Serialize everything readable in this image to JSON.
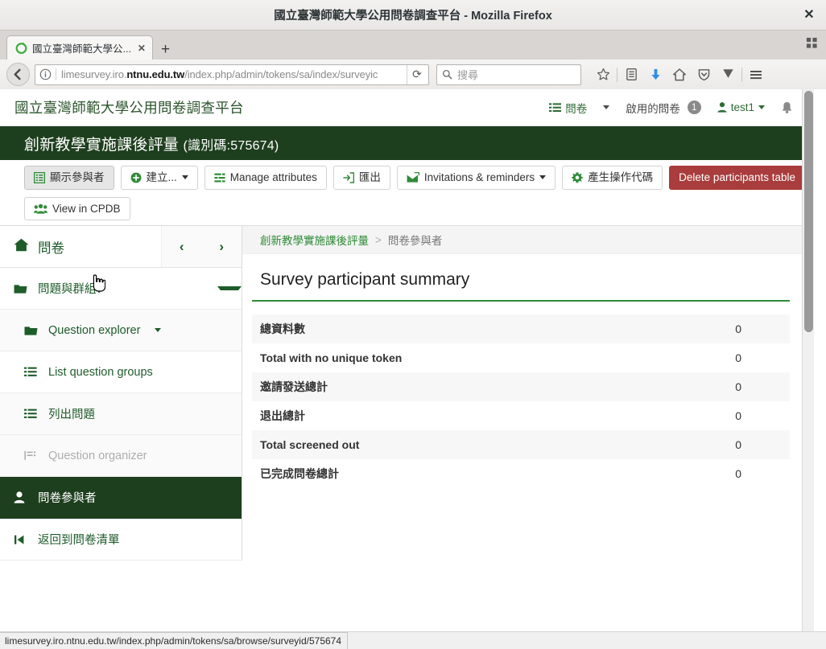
{
  "browser": {
    "window_title": "國立臺灣師範大學公用問卷調查平台 - Mozilla Firefox",
    "close_label": "✕",
    "tab": {
      "label": "國立臺灣師範大學公...",
      "close_label": "✕"
    },
    "new_tab_label": "+",
    "url_prefix": "limesurvey.iro.",
    "url_host_bold": "ntnu.edu.tw",
    "url_suffix": "/index.php/admin/tokens/sa/index/surveyic",
    "reload_label": "⟳",
    "search_placeholder": "搜尋",
    "icons": {
      "back": "back-arrow-icon",
      "identity": "page-info-icon",
      "bookmark_star": "star-icon",
      "library": "library-icon",
      "downloads": "download-arrow-icon",
      "home": "home-icon",
      "shield": "shield-icon",
      "pocket": "pocket-icon",
      "menu": "hamburger-menu-icon"
    },
    "status_url": "limesurvey.iro.ntnu.edu.tw/index.php/admin/tokens/sa/browse/surveyid/575674"
  },
  "app": {
    "brand": "國立臺灣師範大學公用問卷調查平台",
    "topnav": {
      "surveys_label": "問卷",
      "active_surveys_label": "啟用的問卷",
      "active_surveys_count": "1",
      "user_label": "test1",
      "bell_label": "notification-bell"
    },
    "survey_header": {
      "name": "創新教學實施課後評量",
      "id_text": "(識別碼:575674)"
    },
    "toolbar": {
      "buttons": [
        {
          "label": "顯示參與者",
          "icon": "table-list-icon",
          "state": "active",
          "style": "default",
          "caret": false
        },
        {
          "label": "建立...",
          "icon": "plus-circle-icon",
          "state": "normal",
          "style": "default",
          "caret": true
        },
        {
          "label": "Manage attributes",
          "icon": "sliders-icon",
          "state": "normal",
          "style": "default",
          "caret": false
        },
        {
          "label": "匯出",
          "icon": "export-icon",
          "state": "normal",
          "style": "default",
          "caret": false
        },
        {
          "label": "Invitations & reminders",
          "icon": "envelope-icon",
          "state": "normal",
          "style": "default",
          "caret": true
        },
        {
          "label": "產生操作代碼",
          "icon": "gear-icon",
          "state": "normal",
          "style": "default",
          "caret": false
        },
        {
          "label": "Delete participants table",
          "icon": "",
          "state": "normal",
          "style": "danger",
          "caret": false
        }
      ],
      "row2": [
        {
          "label": "View in CPDB",
          "icon": "users-group-icon",
          "state": "normal",
          "style": "default",
          "caret": false
        }
      ]
    },
    "sidebar": {
      "header": {
        "label": "問卷",
        "icon": "home-icon"
      },
      "collapse_prev": "‹",
      "collapse_next": "›",
      "items": [
        {
          "label": "問題與群組：",
          "icon": "folder-icon",
          "caret": true,
          "indent": false,
          "state": "normal",
          "alt": false
        },
        {
          "label": "Question explorer",
          "icon": "folder-icon",
          "caret": true,
          "inline_caret": true,
          "indent": true,
          "state": "normal",
          "alt": true
        },
        {
          "label": "List question groups",
          "icon": "list-icon",
          "caret": false,
          "indent": true,
          "state": "normal",
          "alt": false
        },
        {
          "label": "列出問題",
          "icon": "list-icon",
          "caret": false,
          "indent": true,
          "state": "normal",
          "alt": true
        },
        {
          "label": "Question organizer",
          "icon": "organizer-icon",
          "caret": false,
          "indent": true,
          "state": "disabled",
          "alt": true
        },
        {
          "label": "問卷參與者",
          "icon": "user-icon",
          "caret": false,
          "indent": false,
          "state": "selected",
          "alt": false
        },
        {
          "label": "返回到問卷清單",
          "icon": "skip-back-icon",
          "caret": false,
          "indent": false,
          "state": "normal",
          "alt": false
        }
      ]
    },
    "content": {
      "breadcrumb": {
        "parent": "創新教學實施課後評量",
        "separator": ">",
        "current": "問卷參與者"
      },
      "panel_title": "Survey participant summary",
      "summary_rows": [
        {
          "label": "總資料數",
          "value": "0"
        },
        {
          "label": "Total with no unique token",
          "value": "0"
        },
        {
          "label": "邀請發送總計",
          "value": "0"
        },
        {
          "label": "退出總計",
          "value": "0"
        },
        {
          "label": "Total screened out",
          "value": "0"
        },
        {
          "label": "已完成問卷總計",
          "value": "0"
        }
      ]
    }
  },
  "colors": {
    "brand_green": "#2b542c",
    "header_dark_green": "#1e3f1e",
    "accent_green": "#2e8b37",
    "danger_red": "#a93c3c"
  }
}
